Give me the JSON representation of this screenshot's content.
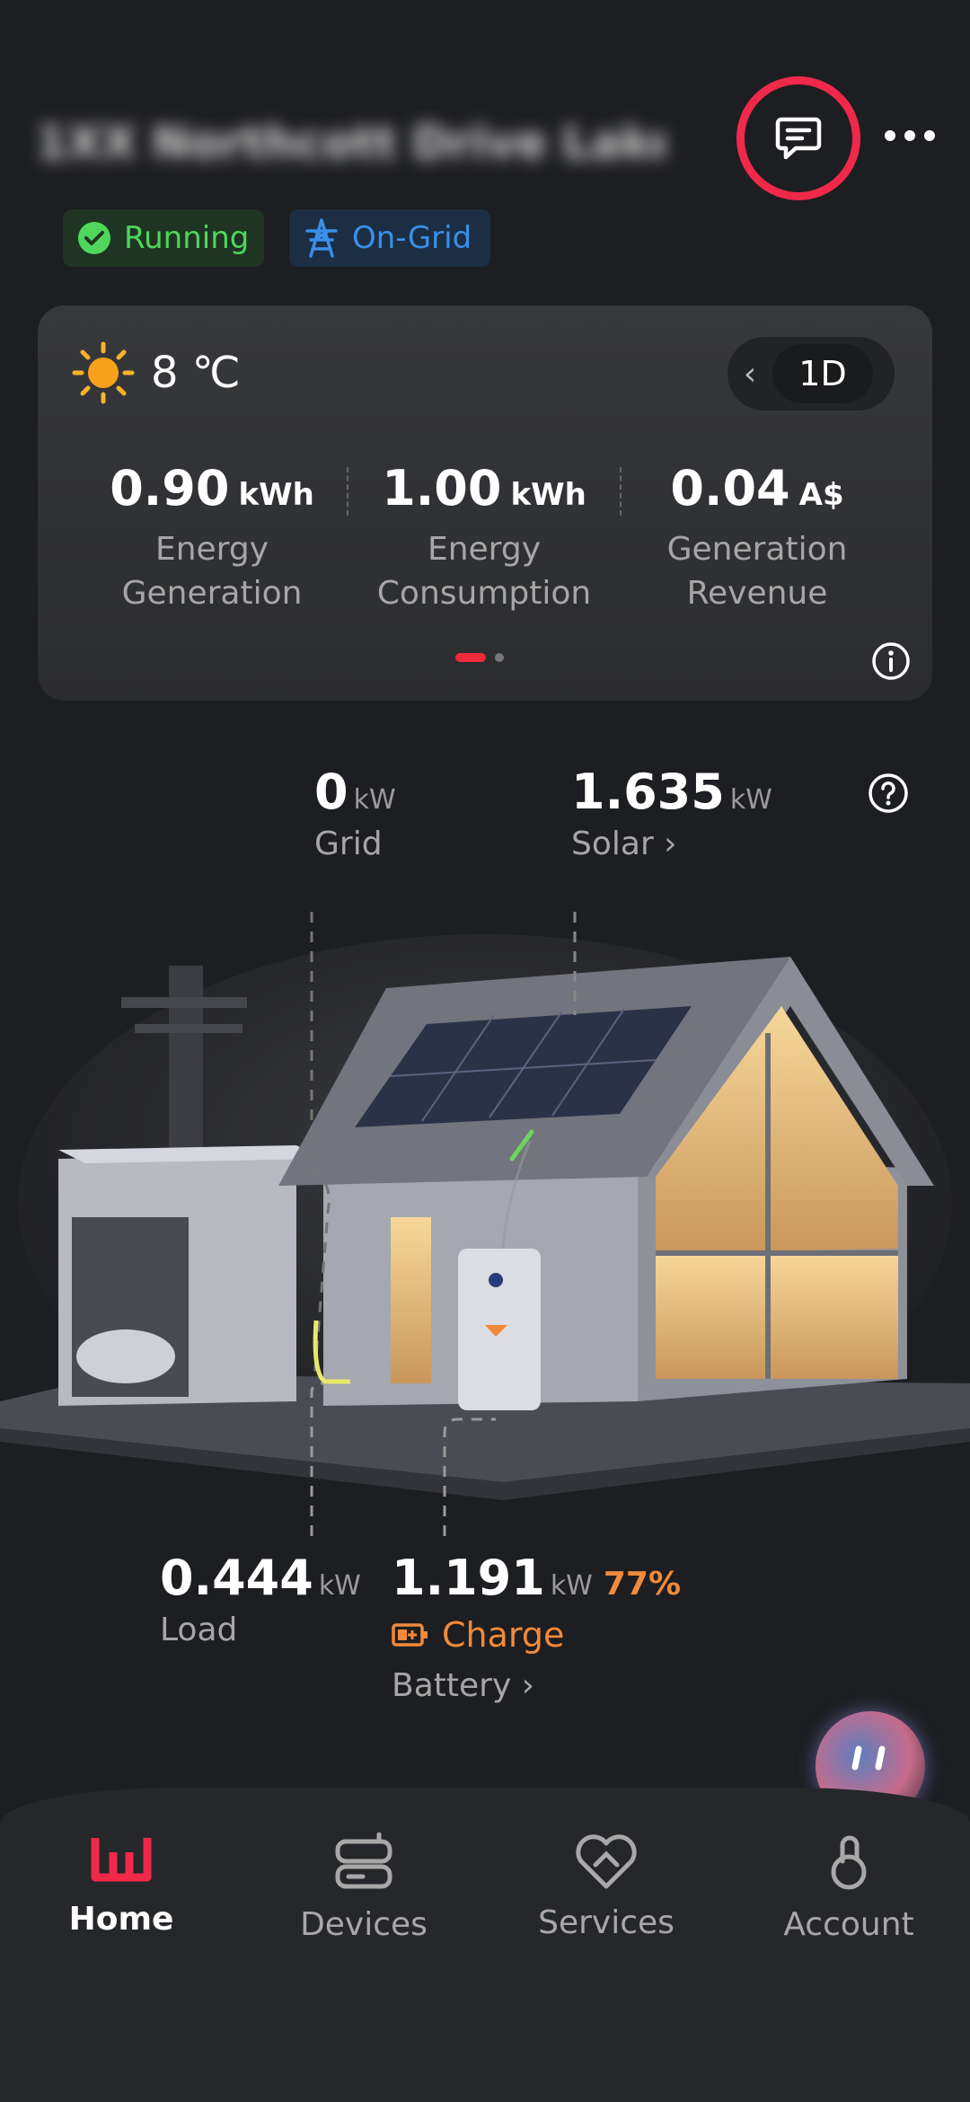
{
  "header": {
    "site_address": "1XX Northcott Drive Lake...",
    "status_running": "Running",
    "status_grid": "On-Grid"
  },
  "summary_card": {
    "weather_icon": "sun-icon",
    "temperature": "8 ℃",
    "period_label": "1D",
    "stats": [
      {
        "value": "0.90",
        "unit": "kWh",
        "label_line1": "Energy",
        "label_line2": "Generation"
      },
      {
        "value": "1.00",
        "unit": "kWh",
        "label_line1": "Energy",
        "label_line2": "Consumption"
      },
      {
        "value": "0.04",
        "unit": "A$",
        "label_line1": "Generation",
        "label_line2": "Revenue"
      }
    ]
  },
  "flow": {
    "grid": {
      "value": "0",
      "unit": "kW",
      "label": "Grid"
    },
    "solar": {
      "value": "1.635",
      "unit": "kW",
      "label": "Solar ›"
    },
    "load": {
      "value": "0.444",
      "unit": "kW",
      "label": "Load"
    },
    "battery": {
      "value": "1.191",
      "unit": "kW",
      "soc": "77%",
      "state": "Charge",
      "label": "Battery ›"
    }
  },
  "nav": {
    "items": [
      {
        "label": "Home",
        "icon": "home-logo-icon"
      },
      {
        "label": "Devices",
        "icon": "devices-icon"
      },
      {
        "label": "Services",
        "icon": "services-icon"
      },
      {
        "label": "Account",
        "icon": "account-icon"
      }
    ]
  },
  "colors": {
    "accent_red": "#f0294a",
    "running_green": "#4fd65c",
    "grid_blue": "#3a8fe8",
    "battery_orange": "#f08a3a"
  }
}
